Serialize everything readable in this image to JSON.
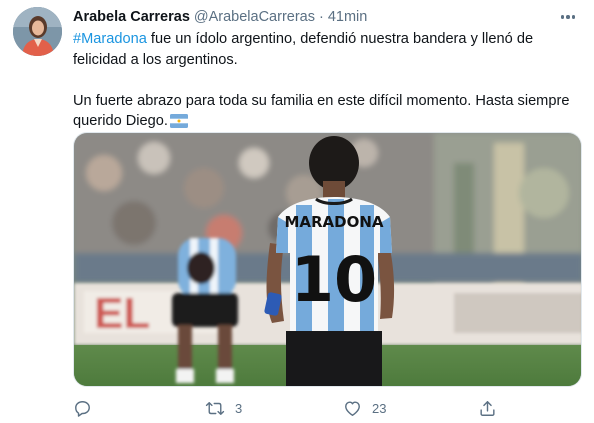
{
  "tweet": {
    "author_name": "Arabela Carreras",
    "author_handle": "@ArabelaCarreras",
    "separator": "·",
    "time": "41min",
    "hashtag": "#Maradona",
    "line1_rest": " fue un ídolo argentino, defendió nuestra bandera y llenó de felicidad a los argentinos.",
    "paragraph2": "Un fuerte abrazo para toda su familia en este difícil momento. Hasta siempre querido Diego.",
    "flag_emoji": "argentina-flag"
  },
  "media": {
    "jersey_name": "MARADONA",
    "jersey_number": "10",
    "ad_board_text": "EL"
  },
  "actions": {
    "reply_count": "",
    "retweet_count": "3",
    "like_count": "23",
    "share_count": ""
  },
  "colors": {
    "link": "#1b95e0",
    "secondary_text": "#5b7083",
    "jersey_sky_blue": "#75aadb"
  },
  "icons": {
    "reply": "reply-icon",
    "retweet": "retweet-icon",
    "like": "heart-icon",
    "share": "share-icon",
    "more": "more-icon"
  }
}
